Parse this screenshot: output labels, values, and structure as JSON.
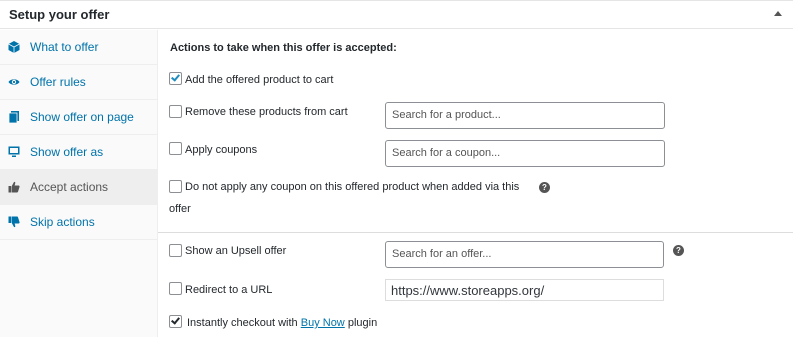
{
  "header": {
    "title": "Setup your offer"
  },
  "sidebar": {
    "items": [
      {
        "label": "What to offer",
        "icon": "cube-icon"
      },
      {
        "label": "Offer rules",
        "icon": "eye-icon"
      },
      {
        "label": "Show offer on page",
        "icon": "page-icon"
      },
      {
        "label": "Show offer as",
        "icon": "desktop-icon"
      },
      {
        "label": "Accept actions",
        "icon": "thumbs-up-icon",
        "active": true
      },
      {
        "label": "Skip actions",
        "icon": "thumbs-down-icon"
      }
    ]
  },
  "main": {
    "heading": "Actions to take when this offer is accepted:",
    "options": {
      "add_product": {
        "label": "Add the offered product to cart",
        "checked": true
      },
      "remove_products": {
        "label": "Remove these products from cart",
        "checked": false,
        "placeholder": "Search for a product..."
      },
      "apply_coupons": {
        "label": "Apply coupons",
        "checked": false,
        "placeholder": "Search for a coupon..."
      },
      "no_coupon": {
        "label_line1": "Do not apply any coupon on this offered product when added via this",
        "label_line2": "offer",
        "checked": false,
        "help": "?"
      },
      "upsell": {
        "label": "Show an Upsell offer",
        "checked": false,
        "placeholder": "Search for an offer...",
        "help": "?"
      },
      "redirect": {
        "label": "Redirect to a URL",
        "checked": false,
        "value": "https://www.storeapps.org/"
      },
      "instant_checkout": {
        "label_before": "Instantly checkout with",
        "link": "Buy Now",
        "label_after": "plugin",
        "checked": true
      }
    }
  },
  "colors": {
    "link": "#0073aa",
    "text": "#23282d",
    "active_tab_bg": "#eeeeee",
    "sidebar_bg": "#fafafa",
    "checkmark": "#1e8cbe"
  }
}
